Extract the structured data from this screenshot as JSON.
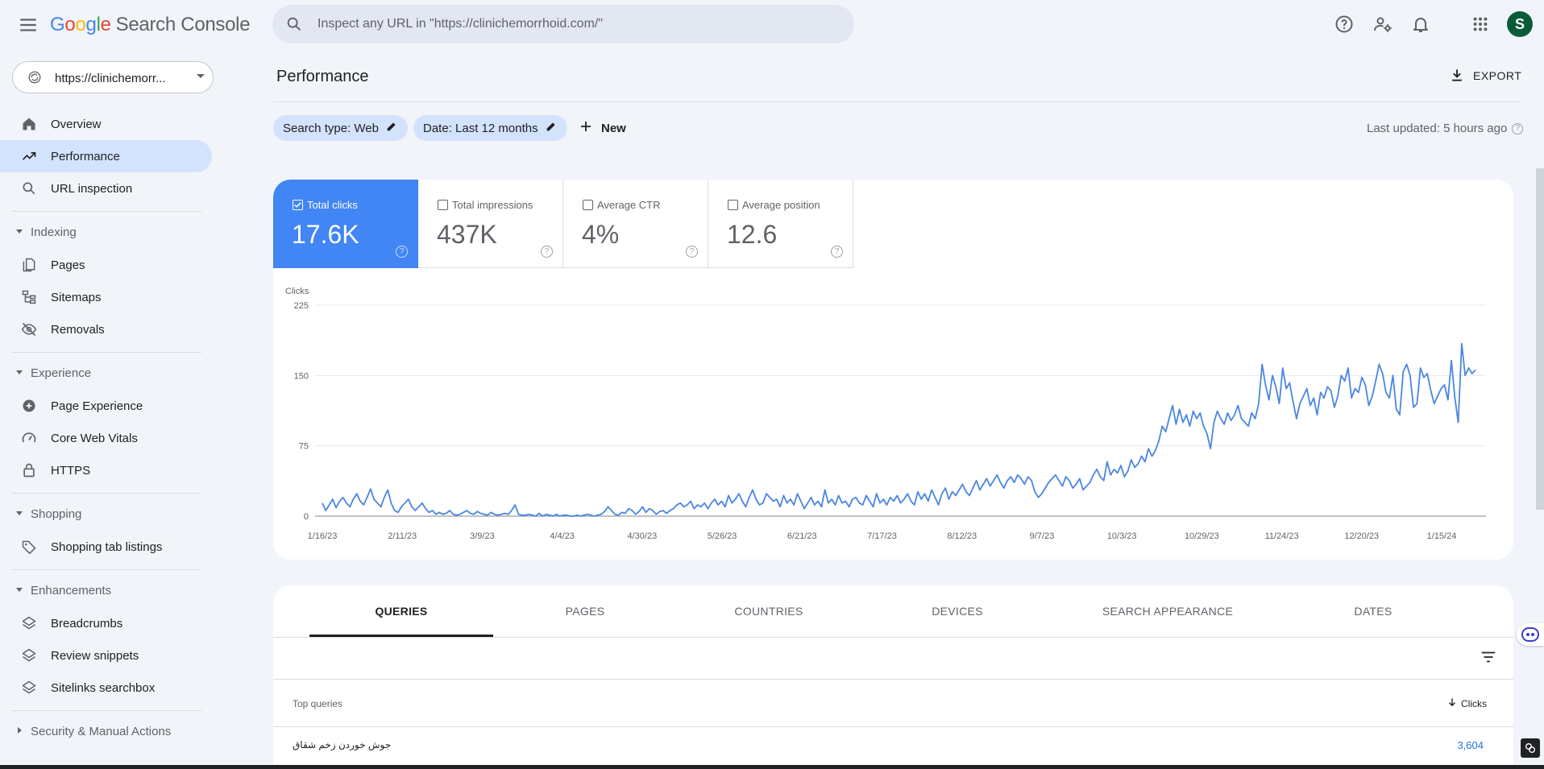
{
  "app": {
    "logo_google": "Google",
    "logo_product": "Search Console"
  },
  "search": {
    "placeholder": "Inspect any URL in \"https://clinichemorrhoid.com/\"",
    "value": ""
  },
  "user": {
    "initial": "S"
  },
  "property": {
    "label": "https://clinichemorr..."
  },
  "sidebar": {
    "overview": "Overview",
    "performance": "Performance",
    "url_inspection": "URL inspection",
    "indexing": {
      "title": "Indexing",
      "items": [
        "Pages",
        "Sitemaps",
        "Removals"
      ]
    },
    "experience": {
      "title": "Experience",
      "items": [
        "Page Experience",
        "Core Web Vitals",
        "HTTPS"
      ]
    },
    "shopping": {
      "title": "Shopping",
      "items": [
        "Shopping tab listings"
      ]
    },
    "enhancements": {
      "title": "Enhancements",
      "items": [
        "Breadcrumbs",
        "Review snippets",
        "Sitelinks searchbox"
      ]
    },
    "security": {
      "title": "Security & Manual Actions"
    }
  },
  "header": {
    "title": "Performance",
    "export_label": "EXPORT",
    "chip_search_type": "Search type: Web",
    "chip_date": "Date: Last 12 months",
    "new_label": "New",
    "last_updated": "Last updated: 5 hours ago"
  },
  "metrics": [
    {
      "label": "Total clicks",
      "value": "17.6K",
      "checked": true
    },
    {
      "label": "Total impressions",
      "value": "437K",
      "checked": false
    },
    {
      "label": "Average CTR",
      "value": "4%",
      "checked": false
    },
    {
      "label": "Average position",
      "value": "12.6",
      "checked": false
    }
  ],
  "colors": {
    "accent": "#4285f4",
    "line": "#4a86e0",
    "active_nav": "#d3e3fd"
  },
  "chart_data": {
    "type": "line",
    "ylabel": "Clicks",
    "ylim": [
      0,
      225
    ],
    "yticks": [
      0,
      75,
      150,
      225
    ],
    "xticks": [
      "1/16/23",
      "2/11/23",
      "3/9/23",
      "4/4/23",
      "4/30/23",
      "5/26/23",
      "6/21/23",
      "7/17/23",
      "8/12/23",
      "9/7/23",
      "10/3/23",
      "10/29/23",
      "11/24/23",
      "12/20/23",
      "1/15/24"
    ],
    "grid": true,
    "series": [
      {
        "values": [
          14,
          6,
          12,
          18,
          9,
          16,
          20,
          14,
          10,
          18,
          24,
          16,
          12,
          20,
          29,
          18,
          14,
          10,
          20,
          28,
          14,
          6,
          4,
          10,
          14,
          18,
          10,
          6,
          10,
          14,
          8,
          4,
          6,
          2,
          4,
          2,
          3,
          6,
          2,
          1,
          2,
          4,
          6,
          3,
          2,
          5,
          3,
          2,
          1,
          4,
          2,
          1,
          2,
          3,
          2,
          6,
          12,
          2,
          1,
          1,
          2,
          1,
          0,
          3,
          0,
          2,
          1,
          0,
          2,
          0,
          1,
          1,
          0,
          0,
          1,
          0,
          1,
          2,
          1,
          0,
          1,
          2,
          5,
          10,
          6,
          2,
          1,
          4,
          3,
          8,
          6,
          2,
          5,
          10,
          4,
          8,
          6,
          2,
          5,
          6,
          3,
          6,
          8,
          12,
          14,
          10,
          12,
          16,
          8,
          12,
          10,
          14,
          8,
          14,
          18,
          12,
          16,
          10,
          22,
          14,
          18,
          24,
          16,
          10,
          20,
          28,
          18,
          12,
          14,
          24,
          20,
          16,
          18,
          10,
          22,
          14,
          18,
          12,
          24,
          16,
          8,
          14,
          20,
          12,
          16,
          10,
          28,
          14,
          18,
          12,
          22,
          14,
          16,
          10,
          18,
          20,
          14,
          12,
          22,
          16,
          10,
          24,
          14,
          18,
          12,
          20,
          16,
          22,
          14,
          18,
          24,
          16,
          12,
          26,
          18,
          24,
          16,
          28,
          20,
          12,
          24,
          30,
          18,
          26,
          22,
          28,
          34,
          26,
          22,
          30,
          38,
          28,
          34,
          40,
          32,
          38,
          44,
          36,
          30,
          38,
          42,
          36,
          44,
          40,
          34,
          42,
          38,
          26,
          20,
          24,
          30,
          36,
          40,
          44,
          38,
          32,
          42,
          38,
          30,
          34,
          40,
          28,
          32,
          36,
          44,
          50,
          42,
          38,
          58,
          44,
          50,
          46,
          54,
          42,
          48,
          60,
          52,
          56,
          64,
          58,
          72,
          64,
          70,
          80,
          96,
          90,
          104,
          118,
          98,
          114,
          100,
          108,
          96,
          112,
          104,
          110,
          96,
          88,
          72,
          100,
          112,
          104,
          98,
          110,
          102,
          108,
          118,
          104,
          100,
          96,
          110,
          104,
          120,
          162,
          140,
          124,
          150,
          138,
          120,
          158,
          136,
          142,
          122,
          104,
          120,
          128,
          136,
          118,
          126,
          108,
          132,
          126,
          138,
          134,
          116,
          128,
          150,
          144,
          158,
          126,
          136,
          132,
          148,
          140,
          118,
          128,
          144,
          162,
          152,
          132,
          126,
          150,
          114,
          108,
          154,
          162,
          150,
          116,
          120,
          158,
          148,
          152,
          134,
          120,
          128,
          136,
          140,
          124,
          166,
          126,
          100,
          184,
          150,
          158,
          152,
          156
        ]
      }
    ]
  },
  "table": {
    "tabs": [
      "QUERIES",
      "PAGES",
      "COUNTRIES",
      "DEVICES",
      "SEARCH APPEARANCE",
      "DATES"
    ],
    "col_left": "Top queries",
    "col_right": "Clicks",
    "rows": [
      {
        "query": "جوش خوردن زخم شقاق",
        "clicks": "3,604"
      }
    ]
  }
}
